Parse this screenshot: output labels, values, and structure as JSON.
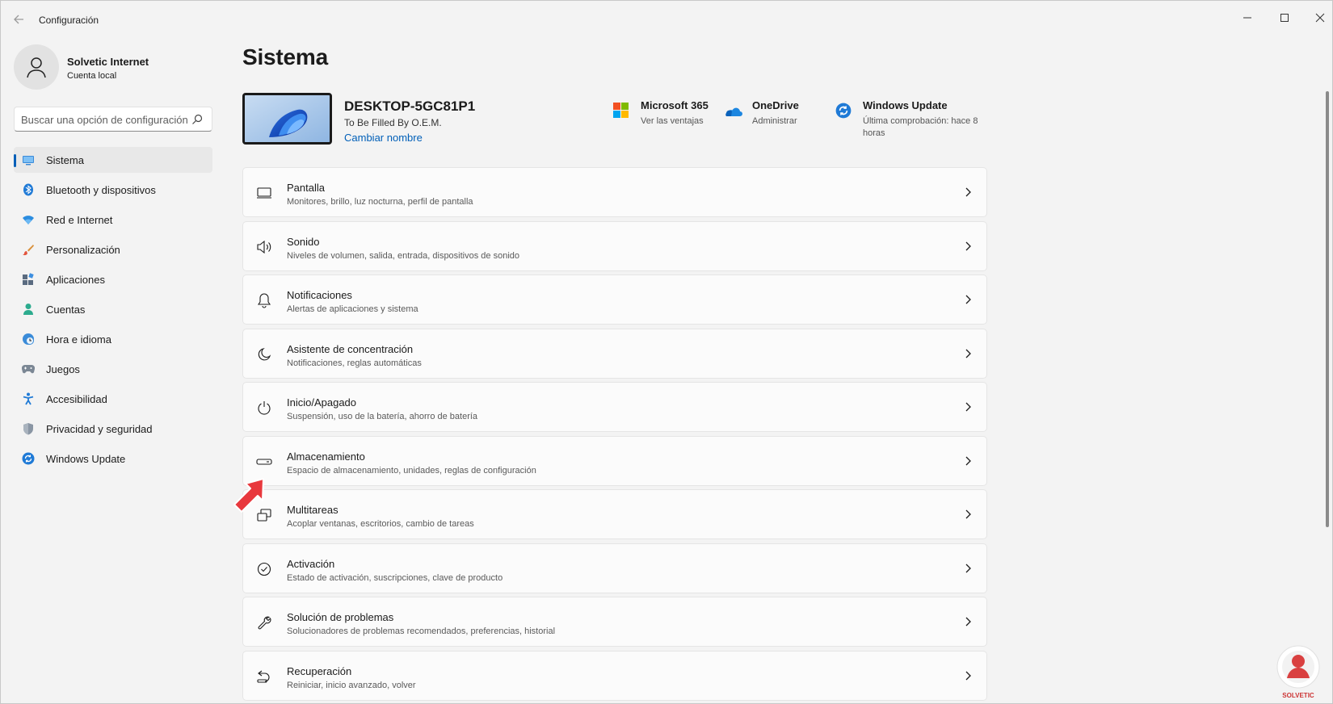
{
  "window": {
    "title": "Configuración",
    "controls": {
      "minimize": "minimize-icon",
      "maximize": "maximize-icon",
      "close": "close-icon"
    }
  },
  "profile": {
    "name": "Solvetic Internet",
    "account_type": "Cuenta local"
  },
  "search": {
    "placeholder": "Buscar una opción de configuración"
  },
  "sidebar": {
    "items": [
      {
        "label": "Sistema",
        "icon": "system-icon",
        "active": true
      },
      {
        "label": "Bluetooth y dispositivos",
        "icon": "bluetooth-icon"
      },
      {
        "label": "Red e Internet",
        "icon": "wifi-icon"
      },
      {
        "label": "Personalización",
        "icon": "brush-icon"
      },
      {
        "label": "Aplicaciones",
        "icon": "apps-icon"
      },
      {
        "label": "Cuentas",
        "icon": "person-icon"
      },
      {
        "label": "Hora e idioma",
        "icon": "clock-globe-icon"
      },
      {
        "label": "Juegos",
        "icon": "gamepad-icon"
      },
      {
        "label": "Accesibilidad",
        "icon": "accessibility-icon"
      },
      {
        "label": "Privacidad y seguridad",
        "icon": "shield-icon"
      },
      {
        "label": "Windows Update",
        "icon": "update-icon"
      }
    ]
  },
  "main": {
    "title": "Sistema",
    "device": {
      "name": "DESKTOP-5GC81P1",
      "model": "To Be Filled By O.E.M.",
      "rename_link": "Cambiar nombre"
    },
    "quick_links": [
      {
        "title": "Microsoft 365",
        "subtitle": "Ver las ventajas",
        "icon": "microsoft-logo-icon"
      },
      {
        "title": "OneDrive",
        "subtitle": "Administrar",
        "icon": "onedrive-icon"
      },
      {
        "title": "Windows Update",
        "subtitle": "Última comprobación: hace 8 horas",
        "icon": "update-icon"
      }
    ],
    "cards": [
      {
        "title": "Pantalla",
        "subtitle": "Monitores, brillo, luz nocturna, perfil de pantalla",
        "icon": "display-icon"
      },
      {
        "title": "Sonido",
        "subtitle": "Niveles de volumen, salida, entrada, dispositivos de sonido",
        "icon": "speaker-icon"
      },
      {
        "title": "Notificaciones",
        "subtitle": "Alertas de aplicaciones y sistema",
        "icon": "bell-icon"
      },
      {
        "title": "Asistente de concentración",
        "subtitle": "Notificaciones, reglas automáticas",
        "icon": "moon-icon"
      },
      {
        "title": "Inicio/Apagado",
        "subtitle": "Suspensión, uso de la batería, ahorro de batería",
        "icon": "power-icon"
      },
      {
        "title": "Almacenamiento",
        "subtitle": "Espacio de almacenamiento, unidades, reglas de configuración",
        "icon": "storage-icon"
      },
      {
        "title": "Multitareas",
        "subtitle": "Acoplar ventanas, escritorios, cambio de tareas",
        "icon": "multitask-icon"
      },
      {
        "title": "Activación",
        "subtitle": "Estado de activación, suscripciones, clave de producto",
        "icon": "check-circle-icon"
      },
      {
        "title": "Solución de problemas",
        "subtitle": "Solucionadores de problemas recomendados, preferencias, historial",
        "icon": "wrench-icon"
      },
      {
        "title": "Recuperación",
        "subtitle": "Reiniciar, inicio avanzado, volver",
        "icon": "recovery-icon"
      }
    ]
  },
  "colors": {
    "accent": "#005fb8",
    "background": "#f3f3f3",
    "card": "#fbfbfb",
    "annotation_arrow": "#e8383d"
  },
  "annotation": {
    "icon": "red-pointer-arrow-icon",
    "target": "Almacenamiento"
  },
  "watermark": {
    "icon": "solvetic-logo-icon",
    "text": "SOLVETIC"
  }
}
